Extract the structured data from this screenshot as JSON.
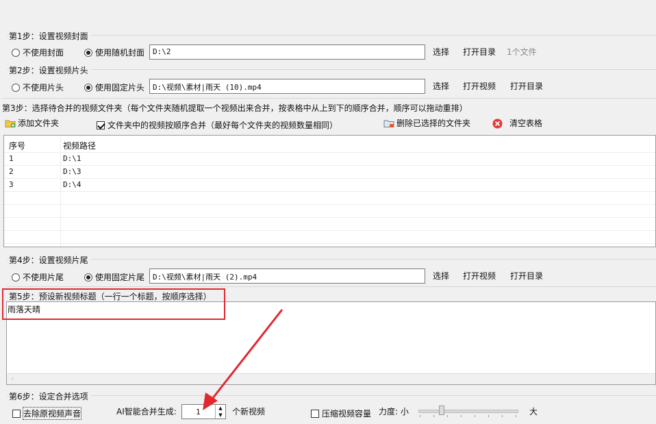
{
  "step1": {
    "title": "第1步：设置视频封面",
    "option_none": "不使用封面",
    "option_random": "使用随机封面",
    "path": "D:\\2",
    "choose": "选择",
    "open_dir": "打开目录",
    "file_count": "1个文件"
  },
  "step2": {
    "title": "第2步：设置视频片头",
    "option_none": "不使用片头",
    "option_fixed": "使用固定片头",
    "path": "D:\\视频\\素材|雨天 (10).mp4",
    "choose": "选择",
    "open_video": "打开视频",
    "open_dir": "打开目录"
  },
  "step3": {
    "title": "第3步：选择待合并的视频文件夹（每个文件夹随机提取一个视频出来合并，按表格中从上到下的顺序合并，顺序可以拖动重排）",
    "add_folder": "添加文件夹",
    "order_merge": "文件夹中的视频按顺序合并（最好每个文件夹的视频数量相同）",
    "delete_selected": "删除已选择的文件夹",
    "clear_table": "清空表格",
    "columns": [
      "序号",
      "视频路径"
    ],
    "rows": [
      {
        "no": "1",
        "path": "D:\\1"
      },
      {
        "no": "2",
        "path": "D:\\3"
      },
      {
        "no": "3",
        "path": "D:\\4"
      }
    ]
  },
  "step4": {
    "title": "第4步：设置视频片尾",
    "option_none": "不使用片尾",
    "option_fixed": "使用固定片尾",
    "path": "D:\\视频\\素材|雨天 (2).mp4",
    "choose": "选择",
    "open_video": "打开视频",
    "open_dir": "打开目录"
  },
  "step5": {
    "title": "第5步：预设新视频标题（一行一个标题，按顺序选择）",
    "text": "雨落天晴"
  },
  "step6": {
    "title": "第6步：设定合并选项",
    "remove_audio": "去除原视频声音",
    "ai_label": "AI智能合并生成:",
    "ai_value": "1",
    "ai_suffix": "个新视频",
    "compress": "压缩视频容量",
    "strength": "力度: 小",
    "strength_max": "大"
  },
  "colors": {
    "annotation_red": "#e0282e"
  }
}
